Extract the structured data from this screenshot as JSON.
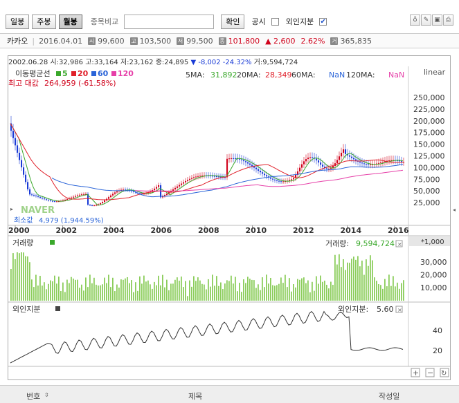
{
  "toolbar": {
    "tab_daily": "일봉",
    "tab_weekly": "주봉",
    "tab_monthly": "월봉",
    "compare_label": "종목비교",
    "compare_value": "",
    "confirm_label": "확인",
    "disclosure_label": "공시",
    "foreign_label": "외인지분",
    "foreign_checked": "✔"
  },
  "info": {
    "stock_name": "카카오",
    "date": "2016.04.01",
    "open_icon": "시",
    "open": "99,600",
    "high_icon": "고",
    "high": "103,500",
    "low_icon": "저",
    "low": "99,500",
    "close_icon": "종",
    "close": "101,800",
    "change": "▲ 2,600",
    "change_pct": "2.62%",
    "volume_icon": "거",
    "volume": "365,835"
  },
  "header_line": {
    "date": "2002.06.28",
    "open": "시:32,986",
    "high": "고:33,164",
    "low": "저:23,162",
    "close": "종:24,895",
    "arrow": "▼",
    "change": "-8,002",
    "change_pct": "-24.32%",
    "volume": "거:9,594,724"
  },
  "ma_legend": {
    "title": "이동평균선",
    "ma5": "5",
    "ma20": "20",
    "ma60": "60",
    "ma120": "120",
    "ma5_label": "5MA:",
    "ma5_val": "31,892",
    "ma20_label": "20MA:",
    "ma20_val": "28,349",
    "ma60_label": "60MA:",
    "ma60_val": "NaN",
    "ma120_label": "120MA:",
    "ma120_val": "NaN",
    "scale": "linear",
    "max_label": "최고 대값",
    "max_val": "264,959 (-61.58%)",
    "min_label": "최소값",
    "min_val": "4,979 (1,944.59%)",
    "watermark": "NAVER"
  },
  "price_axis": [
    "250,000",
    "225,000",
    "200,000",
    "175,000",
    "150,000",
    "125,000",
    "100,000",
    "75,000",
    "50,000",
    "25,000"
  ],
  "year_axis": [
    "2000",
    "2002",
    "2004",
    "2006",
    "2008",
    "2010",
    "2012",
    "2014",
    "2016"
  ],
  "volume_panel": {
    "title": "거래량",
    "value_label": "거래량:",
    "value": "9,594,724",
    "multiplier": "*1,000",
    "axis": [
      "30,000",
      "20,000",
      "10,000"
    ]
  },
  "foreign_panel": {
    "title": "외인지분",
    "value_label": "외인지분:",
    "value": "5.60",
    "axis": [
      "40",
      "20"
    ]
  },
  "zoom": {
    "plus": "+",
    "minus": "−",
    "reset": "↻"
  },
  "table_header": {
    "col_no": "번호",
    "col_title": "제목",
    "col_author": "작성일"
  },
  "colors": {
    "ma5": "#3aa82b",
    "ma20": "#e0202a",
    "ma60": "#2a64d8",
    "ma120": "#e63fa8",
    "up": "#d0021b",
    "down": "#1a3bd6",
    "volume_bar": "#8ccd5c"
  }
}
